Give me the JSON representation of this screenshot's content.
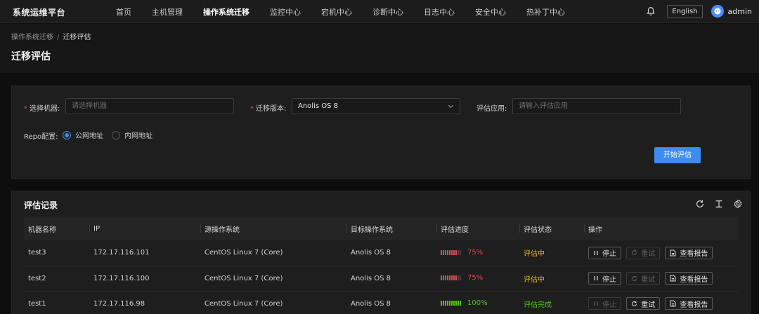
{
  "topnav": {
    "brand": "系统运维平台",
    "items": [
      {
        "label": "首页"
      },
      {
        "label": "主机管理"
      },
      {
        "label": "操作系统迁移"
      },
      {
        "label": "监控中心"
      },
      {
        "label": "宕机中心"
      },
      {
        "label": "诊断中心"
      },
      {
        "label": "日志中心"
      },
      {
        "label": "安全中心"
      },
      {
        "label": "热补丁中心"
      }
    ],
    "active_item": "操作系统迁移",
    "language_button": "English",
    "username": "admin"
  },
  "breadcrumb": {
    "parent": "操作系统迁移",
    "separator": "/",
    "current": "迁移评估"
  },
  "page_title": "迁移评估",
  "form": {
    "machine_label": "选择机器:",
    "machine_placeholder": "请选择机器",
    "version_label": "迁移版本:",
    "version_value": "Anolis OS 8",
    "app_label": "评估应用:",
    "app_placeholder": "请输入评估应用",
    "repo_label": "Repo配置:",
    "repo_options": [
      "公网地址",
      "内网地址"
    ],
    "repo_selected": "公网地址",
    "start_button": "开始评估"
  },
  "records": {
    "title": "评估记录",
    "columns": [
      "机器名称",
      "IP",
      "源操作系统",
      "目标操作系统",
      "评估进度",
      "评估状态",
      "操作"
    ],
    "rows": [
      {
        "name": "test3",
        "ip": "172.17.116.101",
        "source_os": "CentOS Linux 7 (Core)",
        "target_os": "Anolis OS 8",
        "progress": "75%",
        "status": "评估中"
      },
      {
        "name": "test2",
        "ip": "172.17.116.100",
        "source_os": "CentOS Linux 7 (Core)",
        "target_os": "Anolis OS 8",
        "progress": "75%",
        "status": "评估中"
      },
      {
        "name": "test1",
        "ip": "172.17.116.98",
        "source_os": "CentOS Linux 7 (Core)",
        "target_os": "Anolis OS 8",
        "progress": "100%",
        "status": "评估完成"
      }
    ],
    "actions": {
      "stop": "停止",
      "retry": "重试",
      "report": "查看报告"
    }
  },
  "colors": {
    "accent": "#3d8cf0",
    "danger": "#e5484d",
    "success": "#52c41a",
    "warning": "#e5b020"
  },
  "icons": [
    "bell-icon",
    "user-avatar-icon",
    "chevron-down-icon",
    "refresh-icon",
    "column-height-icon",
    "settings-icon",
    "pause-icon",
    "retry-icon",
    "report-file-icon"
  ]
}
